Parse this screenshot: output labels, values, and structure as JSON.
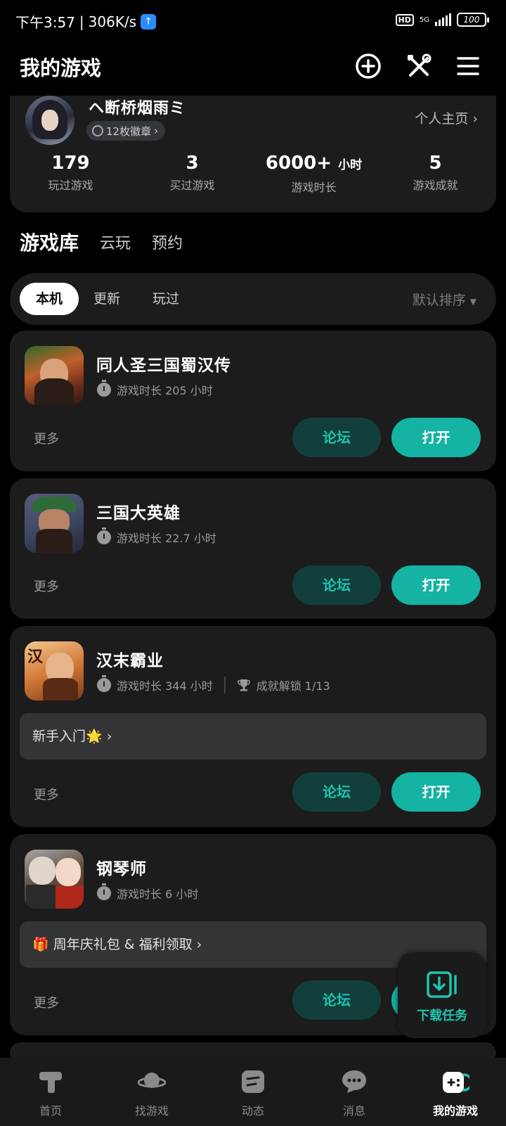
{
  "status_bar": {
    "time": "下午3:57",
    "speed": "306K/s",
    "hd_badge": "HD",
    "network": "5G",
    "battery": "100"
  },
  "header": {
    "title": "我的游戏",
    "icons": [
      "add-circle-icon",
      "tools-icon",
      "menu-icon"
    ]
  },
  "profile": {
    "username": "ヘ断桥烟雨ミ",
    "medals": "12枚徽章",
    "homepage_link": "个人主页",
    "stats": [
      {
        "value": "179",
        "unit": "",
        "label": "玩过游戏"
      },
      {
        "value": "3",
        "unit": "",
        "label": "买过游戏"
      },
      {
        "value": "6000+",
        "unit": "小时",
        "label": "游戏时长"
      },
      {
        "value": "5",
        "unit": "",
        "label": "游戏成就"
      }
    ]
  },
  "main_tabs": [
    {
      "label": "游戏库",
      "active": true
    },
    {
      "label": "云玩",
      "active": false
    },
    {
      "label": "预约",
      "active": false
    }
  ],
  "filters": {
    "chips": [
      {
        "label": "本机",
        "active": true
      },
      {
        "label": "更新",
        "active": false
      },
      {
        "label": "玩过",
        "active": false
      }
    ],
    "sort": "默认排序"
  },
  "games": [
    {
      "name": "同人圣三国蜀汉传",
      "playtime": "游戏时长 205 小时",
      "achievement": "",
      "promo": "",
      "more": "更多",
      "forum": "论坛",
      "open": "打开"
    },
    {
      "name": "三国大英雄",
      "playtime": "游戏时长 22.7 小时",
      "achievement": "",
      "promo": "",
      "more": "更多",
      "forum": "论坛",
      "open": "打开"
    },
    {
      "name": "汉末霸业",
      "playtime": "游戏时长 344 小时",
      "achievement": "成就解锁 1/13",
      "promo": "新手入门🌟",
      "more": "更多",
      "forum": "论坛",
      "open": "打开"
    },
    {
      "name": "钢琴师",
      "playtime": "游戏时长 6 小时",
      "achievement": "",
      "promo": "🎁 周年庆礼包 & 福利领取",
      "more": "更多",
      "forum": "论坛",
      "open": "打开"
    }
  ],
  "download_fab": {
    "label": "下载任务"
  },
  "bottom_nav": [
    {
      "label": "首页",
      "icon": "home-icon",
      "active": false
    },
    {
      "label": "找游戏",
      "icon": "planet-icon",
      "active": false
    },
    {
      "label": "动态",
      "icon": "feed-icon",
      "active": false
    },
    {
      "label": "消息",
      "icon": "chat-bubble-icon",
      "active": false
    },
    {
      "label": "我的游戏",
      "icon": "gamepad-icon",
      "active": true
    }
  ],
  "colors": {
    "accent": "#14b3a3",
    "forum_bg": "#123f3b",
    "card_bg": "#1c1c1c",
    "page_bg": "#000000"
  }
}
